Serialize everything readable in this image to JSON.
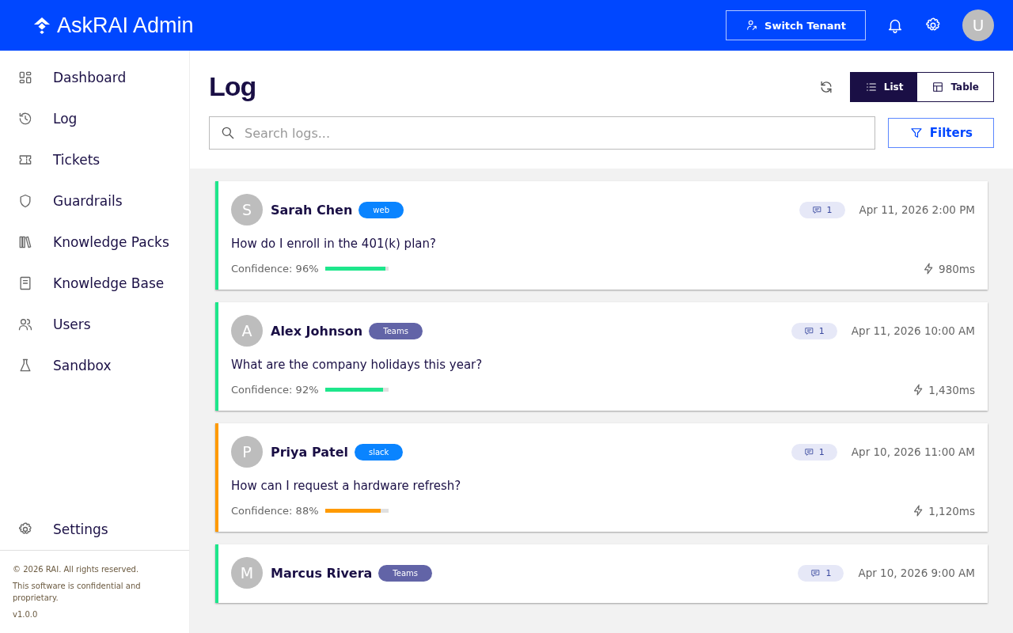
{
  "header": {
    "brand": "AskRAI Admin",
    "switch_button": "Switch Tenant",
    "avatar": "U"
  },
  "sidebar": {
    "items": [
      {
        "label": "Dashboard",
        "kind": "grid"
      },
      {
        "label": "Log",
        "kind": "history"
      },
      {
        "label": "Tickets",
        "kind": "ticket"
      },
      {
        "label": "Guardrails",
        "kind": "shield"
      },
      {
        "label": "Knowledge Packs",
        "kind": "books"
      },
      {
        "label": "Knowledge Base",
        "kind": "book"
      },
      {
        "label": "Users",
        "kind": "users"
      },
      {
        "label": "Sandbox",
        "kind": "flask"
      }
    ],
    "settings": "Settings",
    "footer": [
      "© 2026 RAI. All rights reserved.",
      "This software is confidential and proprietary.",
      "v1.0.0"
    ]
  },
  "page": {
    "title": "Log",
    "view_toggle": [
      {
        "label": "List",
        "kind": "list",
        "selected": true
      },
      {
        "label": "Table",
        "kind": "table",
        "selected": false
      }
    ],
    "search": {
      "placeholder": "Search logs..."
    },
    "filters_button": "Filters"
  },
  "logs": [
    {
      "avatar": "S",
      "name": "Sarah Chen",
      "channel": {
        "label": "web",
        "color": "#0a84ff"
      },
      "color": "#1ee68c",
      "comments": "1",
      "time": "Apr 11, 2026 2:00 PM",
      "question": "How do I enroll in the 401(k) plan?",
      "confidence": "Confidence: 96%",
      "level": 0.96,
      "latency": "980ms"
    },
    {
      "avatar": "A",
      "name": "Alex Johnson",
      "channel": {
        "label": "Teams",
        "color": "#6264a7"
      },
      "color": "#1ee68c",
      "comments": "1",
      "time": "Apr 11, 2026 10:00 AM",
      "question": "What are the company holidays this year?",
      "confidence": "Confidence: 92%",
      "level": 0.92,
      "latency": "1,430ms"
    },
    {
      "avatar": "P",
      "name": "Priya Patel",
      "channel": {
        "label": "slack",
        "color": "#0a84ff"
      },
      "color": "#ff9a00",
      "comments": "1",
      "time": "Apr 10, 2026 11:00 AM",
      "question": "How can I request a hardware refresh?",
      "confidence": "Confidence: 88%",
      "level": 0.88,
      "latency": "1,120ms"
    },
    {
      "avatar": "M",
      "name": "Marcus Rivera",
      "channel": {
        "label": "Teams",
        "color": "#6264a7"
      },
      "color": "#1ee68c",
      "comments": "1",
      "time": "Apr 10, 2026 9:00 AM"
    }
  ]
}
